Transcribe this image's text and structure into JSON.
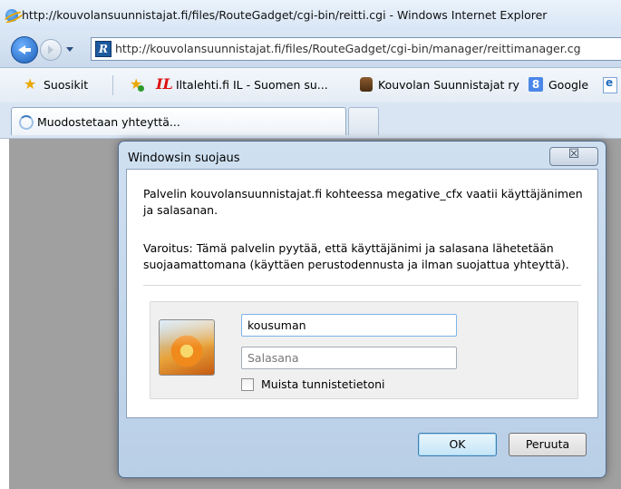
{
  "window": {
    "title": "http://kouvolansuunnistajat.fi/files/RouteGadget/cgi-bin/reitti.cgi - Windows Internet Explorer"
  },
  "address_bar": {
    "url": "http://kouvolansuunnistajat.fi/files/RouteGadget/cgi-bin/manager/reittimanager.cg"
  },
  "favorites_bar": {
    "favorites_label": "Suosikit",
    "items": [
      {
        "label": "Iltalehti.fi IL - Suomen su...",
        "icon": "iltalehti-icon"
      },
      {
        "label": "Kouvolan Suunnistajat ry",
        "icon": "owl-icon"
      },
      {
        "label": "Google",
        "icon": "google-icon"
      }
    ]
  },
  "tab": {
    "title": "Muodostetaan yhteyttä..."
  },
  "dialog": {
    "title": "Windowsin suojaus",
    "close_glyph": "☒",
    "message": "Palvelin kouvolansuunnistajat.fi kohteessa megative_cfx vaatii käyttäjänimen ja salasanan.",
    "warning": "Varoitus: Tämä palvelin pyytää, että käyttäjänimi ja salasana lähetetään suojaamattomana (käyttäen perustodennusta ja ilman suojattua yhteyttä).",
    "username_value": "kousuman",
    "password_placeholder": "Salasana",
    "remember_label": "Muista tunnistetietoni",
    "remember_checked": false,
    "ok_label": "OK",
    "cancel_label": "Peruuta"
  }
}
